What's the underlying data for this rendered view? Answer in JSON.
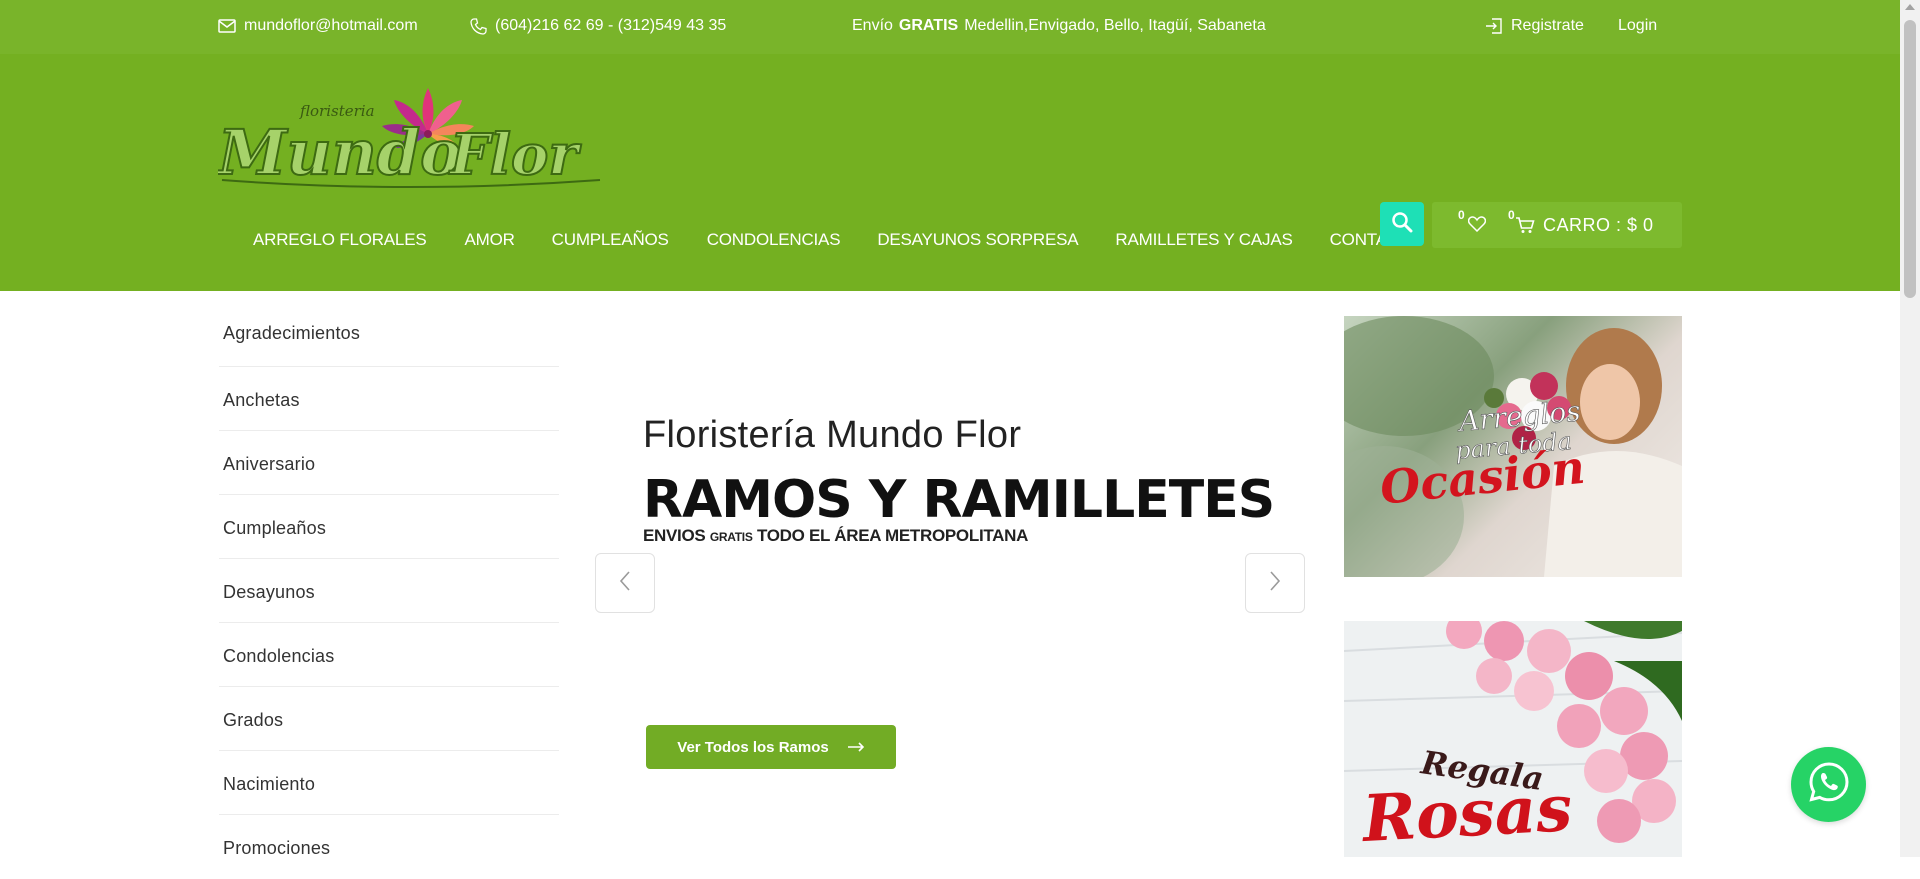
{
  "topbar": {
    "email": "mundoflor@hotmail.com",
    "phone": "(604)216 62 69 - (312)549 43 35",
    "shipping_prefix": "Envío",
    "shipping_bold": "GRATIS",
    "shipping_areas": "Medellin,Envigado, Bello, Itagüí, Sabaneta",
    "register_label": "Registrate",
    "login_label": "Login"
  },
  "logo": {
    "small_text": "floristeria",
    "main_text_1": "Mundo",
    "main_text_2": "Flor"
  },
  "nav": {
    "items": [
      "ARREGLO FLORALES",
      "AMOR",
      "CUMPLEAÑOS",
      "CONDOLENCIAS",
      "DESAYUNOS SORPRESA",
      "RAMILLETES Y CAJAS",
      "CONTACTO"
    ]
  },
  "cart": {
    "wishlist_count": "0",
    "cart_count": "0",
    "label": "CARRO : $ 0"
  },
  "sidebar": {
    "items": [
      "Agradecimientos",
      "Anchetas",
      "Aniversario",
      "Cumpleaños",
      "Desayunos",
      "Condolencias",
      "Grados",
      "Nacimiento",
      "Promociones"
    ]
  },
  "hero": {
    "subtitle": "Floristería Mundo Flor",
    "title": "RAMOS Y RAMILLETES",
    "note_1": "ENVIOS",
    "note_small": "GRATIS",
    "note_2": "TODO EL ÁREA METROPOLITANA",
    "cta_label": "Ver Todos los Ramos"
  },
  "banners": {
    "b1_line1": "Arreglos",
    "b1_line2": "para toda",
    "b1_line3": "Ocasión",
    "b2_line1": "Regala",
    "b2_line2": "Rosas"
  },
  "colors": {
    "topbar": "#79b42a",
    "header": "#74b021",
    "search": "#1ee0b6",
    "cta": "#72ac25",
    "whatsapp": "#26d366"
  },
  "icons": [
    "mail-icon",
    "phone-icon",
    "login-icon",
    "search-icon",
    "heart-icon",
    "cart-icon",
    "chevron-left-icon",
    "chevron-right-icon",
    "arrow-right-icon",
    "whatsapp-icon"
  ]
}
